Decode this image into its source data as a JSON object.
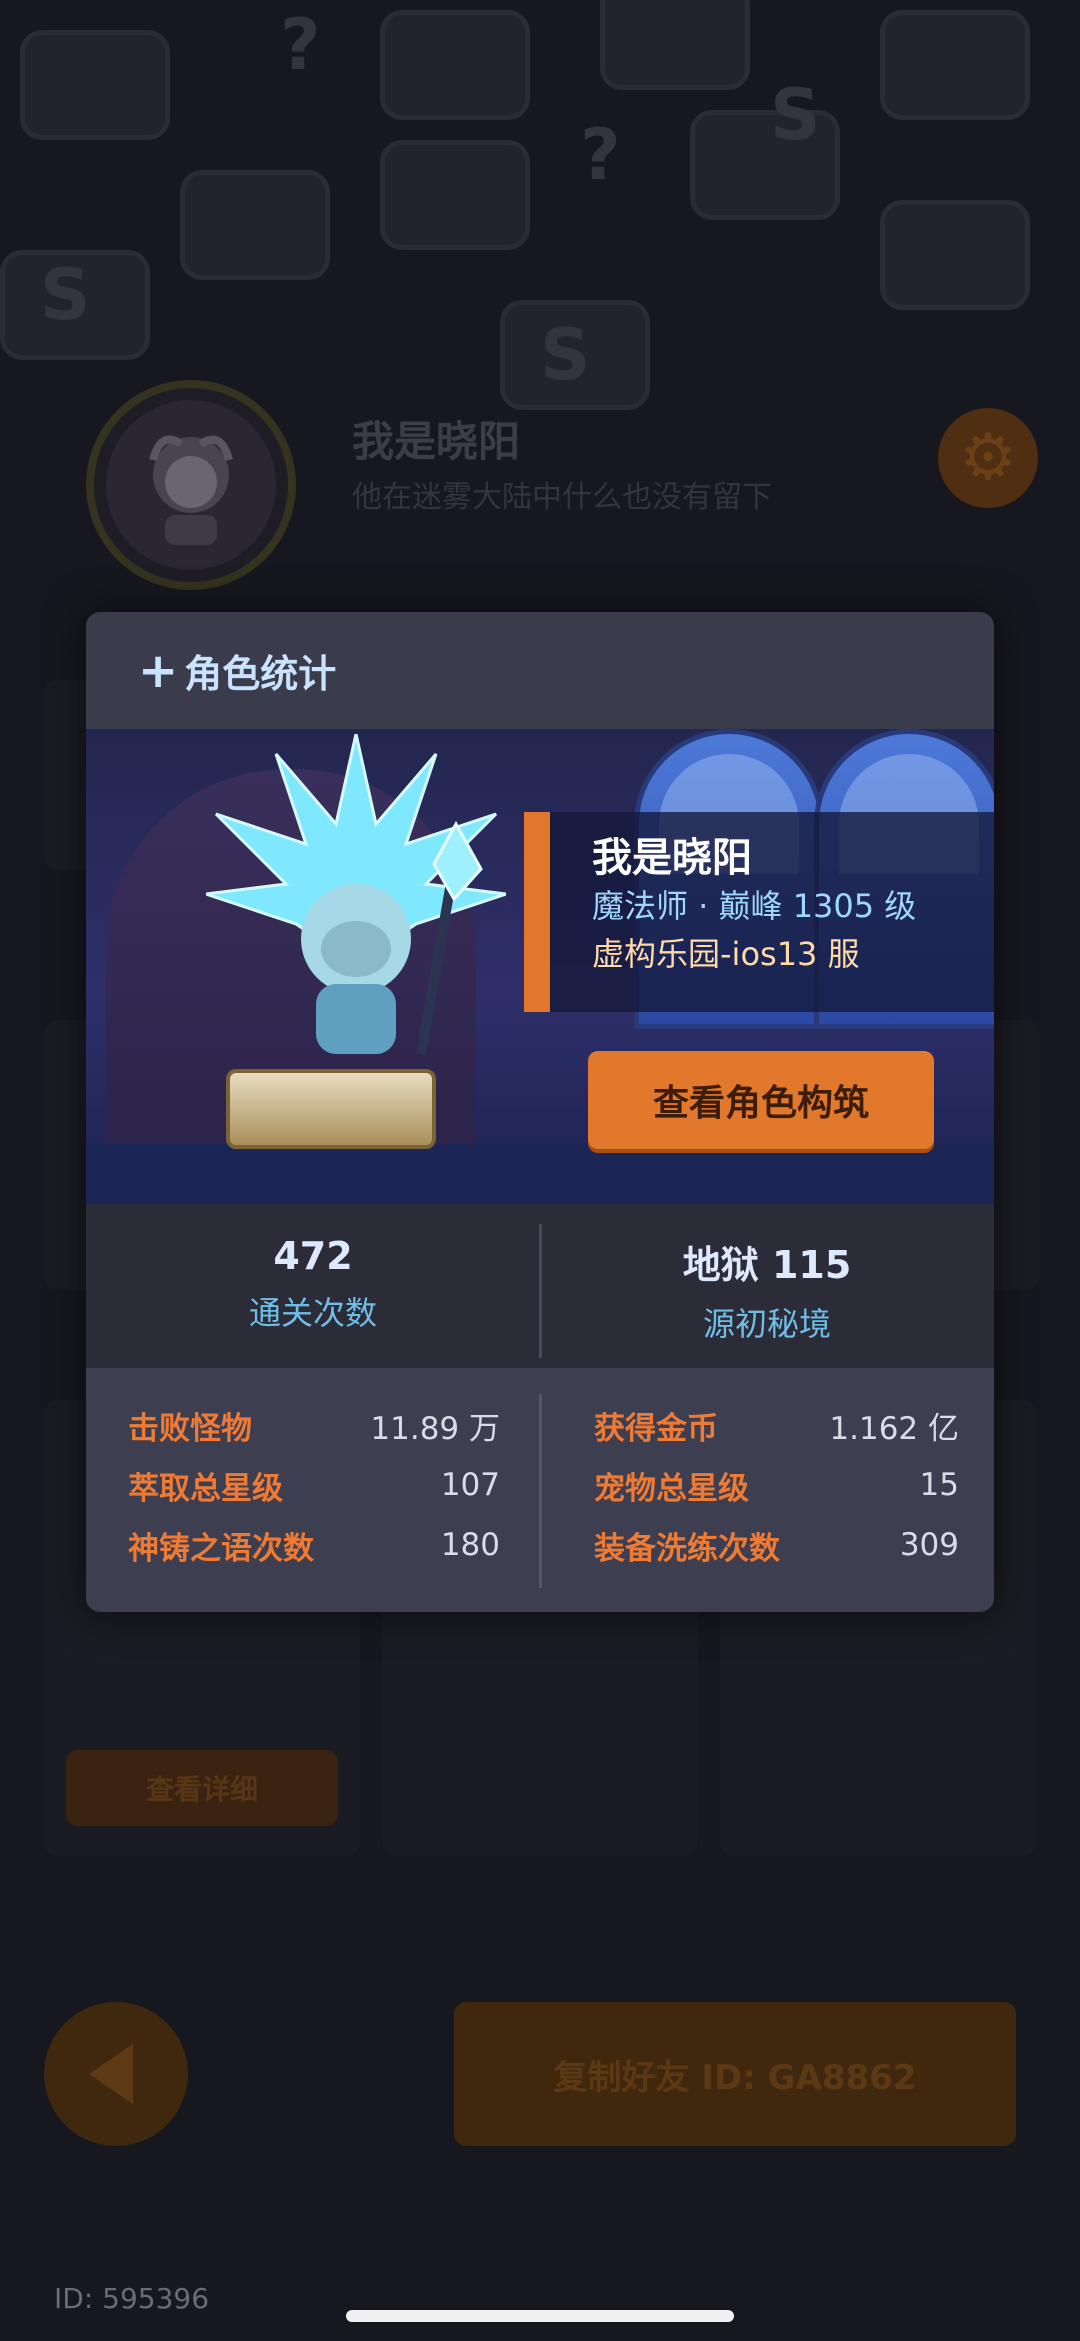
{
  "profile": {
    "name": "我是晓阳",
    "subtitle": "他在迷雾大陆中什么也没有留下"
  },
  "background": {
    "detail_button": "查看详细",
    "copy_friend_button": "复制好友 ID: GA8862",
    "bottom_id": "ID: 595396"
  },
  "modal": {
    "header_icon": "plus-icon",
    "title": "角色统计",
    "character": {
      "name": "我是晓阳",
      "class_level": "魔法师 · 巅峰 1305 级",
      "server": "虚构乐园-ios13 服"
    },
    "build_button": "查看角色构筑",
    "summary": [
      {
        "value": "472",
        "label": "通关次数"
      },
      {
        "value": "地狱 115",
        "label": "源初秘境"
      }
    ],
    "stats_left": [
      {
        "label": "击败怪物",
        "value": "11.89 万"
      },
      {
        "label": "萃取总星级",
        "value": "107"
      },
      {
        "label": "神铸之语次数",
        "value": "180"
      }
    ],
    "stats_right": [
      {
        "label": "获得金币",
        "value": "1.162 亿"
      },
      {
        "label": "宠物总星级",
        "value": "15"
      },
      {
        "label": "装备洗练次数",
        "value": "309"
      }
    ]
  },
  "colors": {
    "accent_orange": "#e2782b",
    "stat_label": "#ef7a33",
    "summary_label": "#6fbde6",
    "modal_bg": "#2b2c38"
  }
}
